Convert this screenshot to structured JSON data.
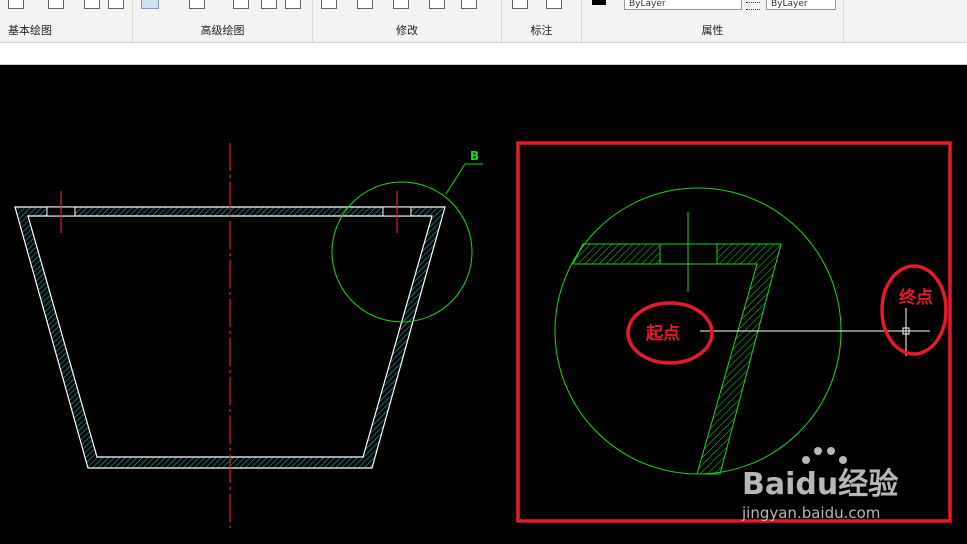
{
  "ribbon": {
    "panels": [
      {
        "label": "基本绘图"
      },
      {
        "label": "高级绘图"
      },
      {
        "label": "修改"
      },
      {
        "label": "标注"
      },
      {
        "label": "属性"
      }
    ],
    "linetype_value": "ByLayer",
    "lineweight_value": "ByLayer"
  },
  "drawing": {
    "detail_label": "B",
    "start_label": "起点",
    "end_label": "终点"
  },
  "watermark": {
    "brand": "Baidu经验",
    "url": "jingyan.baidu.com"
  },
  "colors": {
    "canvas": "#000000",
    "geometry": "#ffffff",
    "hatch": "#00e8e8",
    "centerline": "#e0202a",
    "detail": "#16d916",
    "highlight": "#e8192c"
  }
}
